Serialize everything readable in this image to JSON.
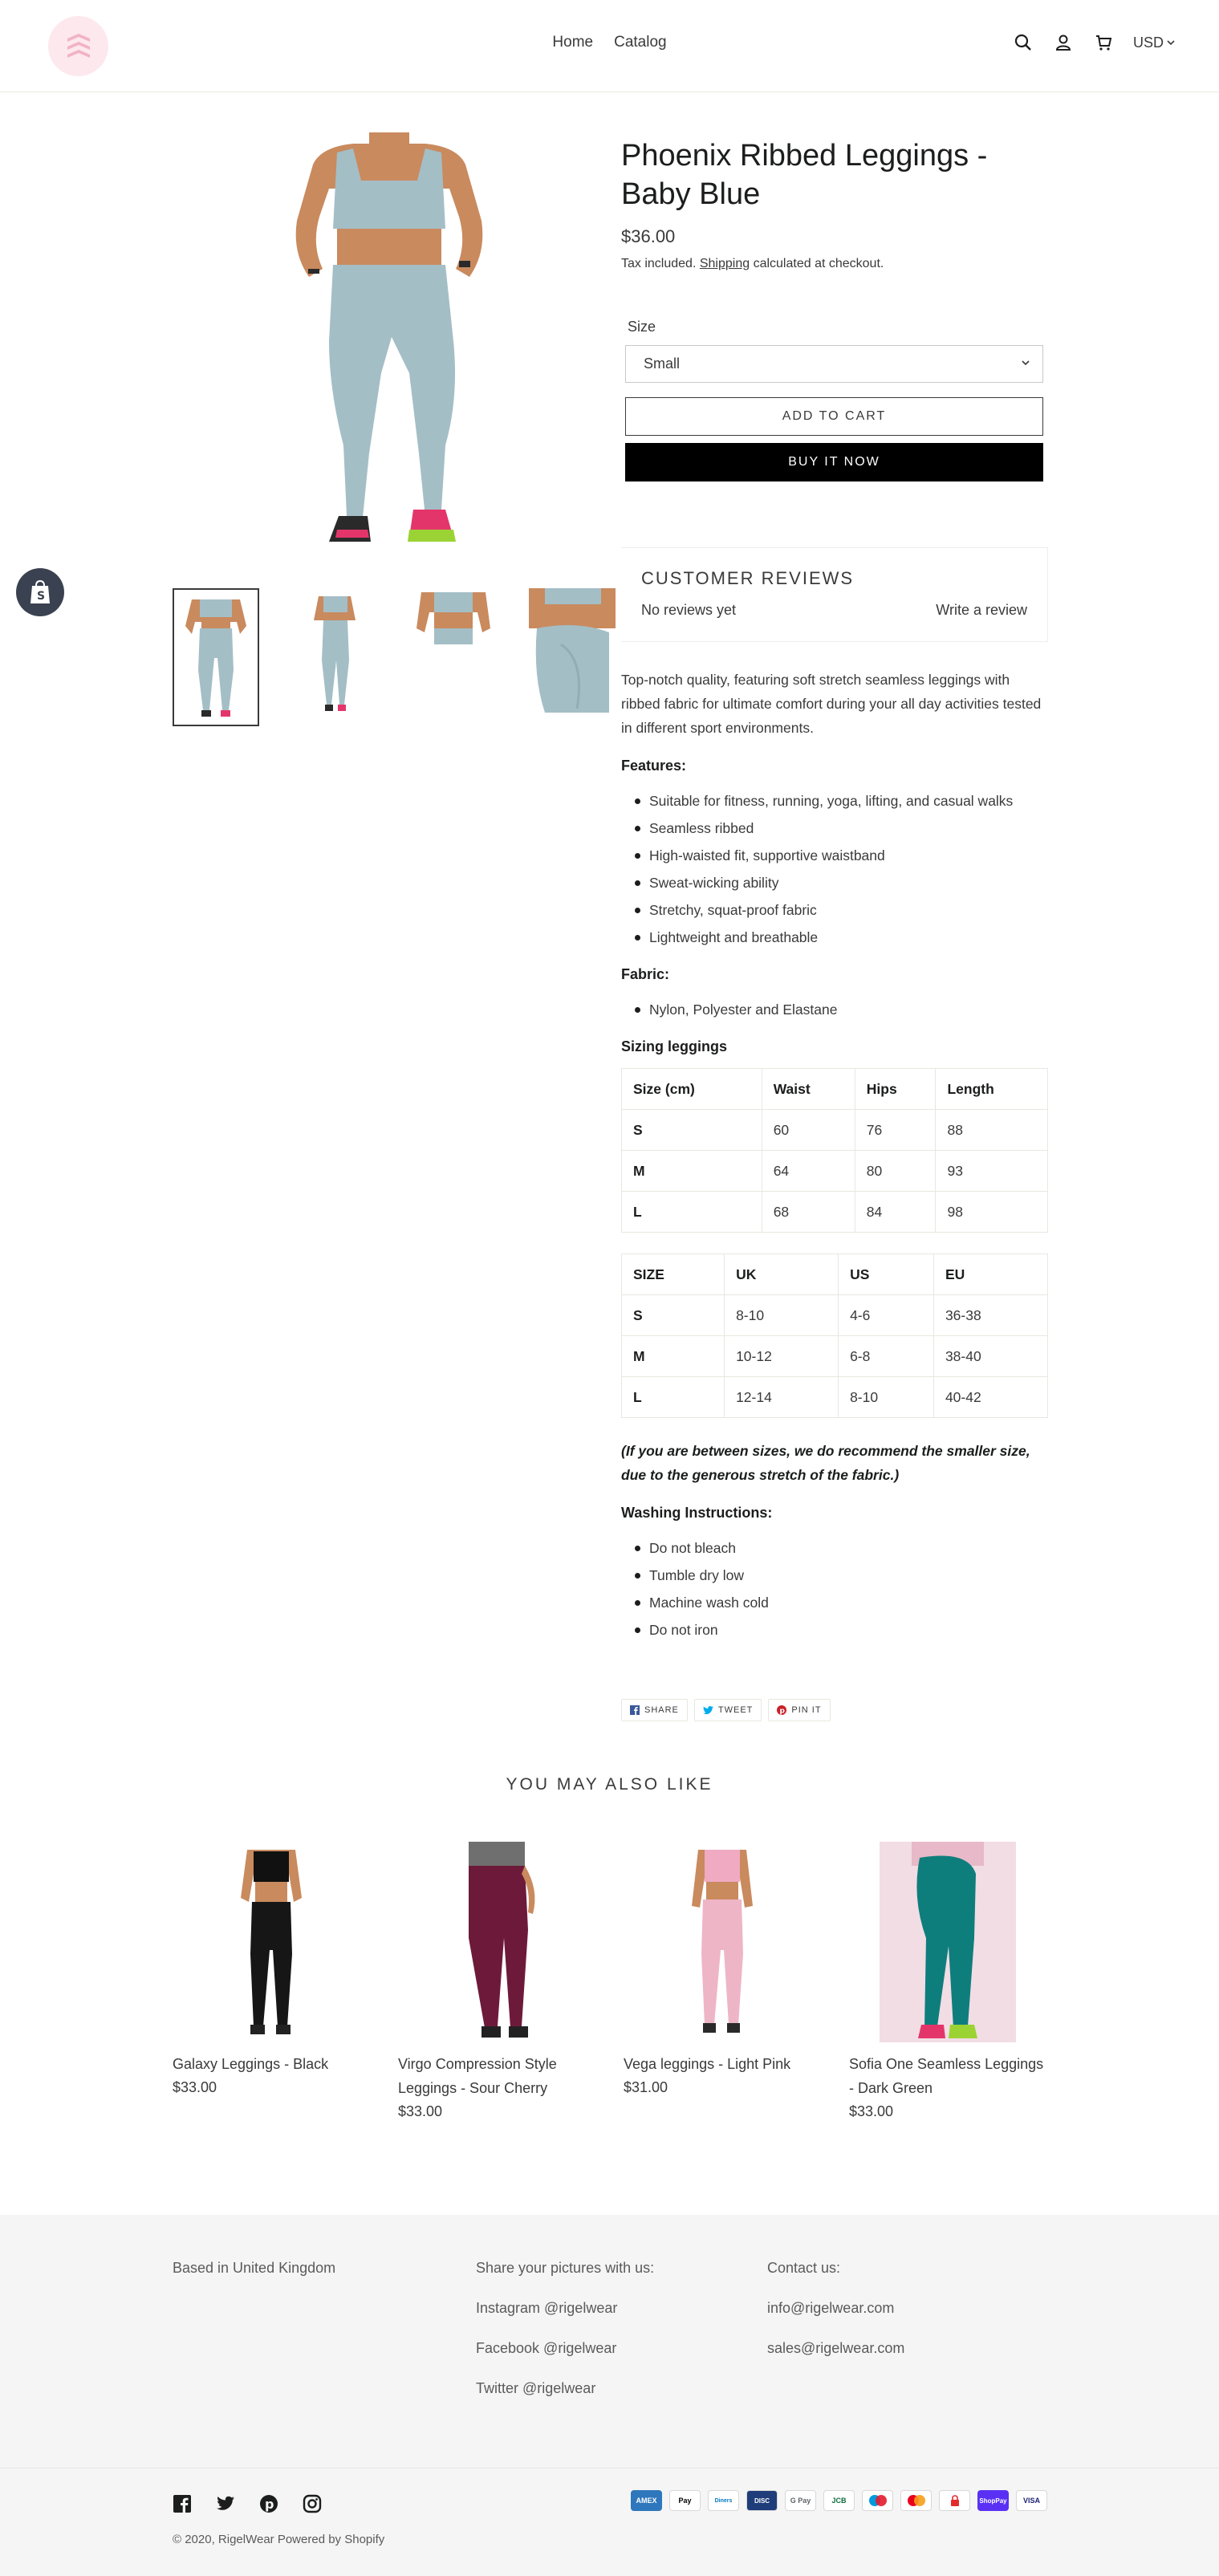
{
  "header": {
    "nav": [
      "Home",
      "Catalog"
    ],
    "currency": "USD"
  },
  "product": {
    "title": "Phoenix Ribbed Leggings - Baby Blue",
    "price": "$36.00",
    "tax_prefix": "Tax included.",
    "tax_link": "Shipping",
    "tax_suffix": "calculated at checkout.",
    "size_label": "Size",
    "size_selected": "Small",
    "add_to_cart": "ADD TO CART",
    "buy_now": "BUY IT NOW"
  },
  "reviews": {
    "title": "CUSTOMER REVIEWS",
    "none": "No reviews yet",
    "write": "Write a review"
  },
  "description": {
    "intro": "Top-notch quality, featuring soft stretch seamless leggings with ribbed fabric for ultimate comfort during your all day activities tested in different sport environments.",
    "features_title": "Features:",
    "features": [
      "Suitable for fitness, running, yoga, lifting, and casual walks",
      "Seamless ribbed",
      "High-waisted fit, supportive waistband",
      "Sweat-wicking ability",
      "Stretchy, squat-proof fabric",
      "Lightweight and breathable"
    ],
    "fabric_title": "Fabric:",
    "fabric": [
      "Nylon, Polyester and Elastane"
    ],
    "sizing_title": "Sizing leggings",
    "table1": [
      [
        "Size (cm)",
        "Waist",
        "Hips",
        "Length"
      ],
      [
        "S",
        "60",
        "76",
        "88"
      ],
      [
        "M",
        "64",
        "80",
        "93"
      ],
      [
        "L",
        "68",
        "84",
        "98"
      ]
    ],
    "table2": [
      [
        "SIZE",
        "UK",
        "US",
        "EU"
      ],
      [
        "S",
        "8-10",
        "4-6",
        "36-38"
      ],
      [
        "M",
        "10-12",
        "6-8",
        "38-40"
      ],
      [
        "L",
        "12-14",
        "8-10",
        "40-42"
      ]
    ],
    "note": "(If you are between sizes, we do recommend the smaller size, due to the generous stretch of the fabric.)",
    "washing_title": "Washing Instructions:",
    "washing": [
      "Do not bleach",
      "Tumble dry low",
      "Machine wash cold",
      "Do not iron"
    ]
  },
  "share": {
    "share": "SHARE",
    "tweet": "TWEET",
    "pin": "PIN IT"
  },
  "recommendations": {
    "title": "YOU MAY ALSO LIKE",
    "items": [
      {
        "name": "Galaxy Leggings - Black",
        "price": "$33.00"
      },
      {
        "name": "Virgo Compression Style Leggings - Sour Cherry",
        "price": "$33.00"
      },
      {
        "name": "Vega leggings - Light Pink",
        "price": "$31.00"
      },
      {
        "name": "Sofia One Seamless Leggings - Dark Green",
        "price": "$33.00"
      }
    ]
  },
  "footer": {
    "col1": [
      "Based in United Kingdom"
    ],
    "col2": [
      "Share your pictures with us:",
      "Instagram @rigelwear",
      "Facebook @rigelwear",
      "Twitter @rigelwear"
    ],
    "col3": [
      "Contact us:",
      "info@rigelwear.com",
      "sales@rigelwear.com"
    ],
    "copyright": "© 2020, RigelWear Powered by Shopify",
    "payments": [
      "AMEX",
      "Pay",
      "Diners",
      "DISC",
      "G Pay",
      "JCB",
      "Maestro",
      "MC",
      "",
      "ShopPay",
      "VISA"
    ]
  },
  "colors": {
    "accent": "#000000",
    "text": "#3a3a3a",
    "footer_bg": "#f5f5f5",
    "logo_bg": "#fde8ee"
  }
}
